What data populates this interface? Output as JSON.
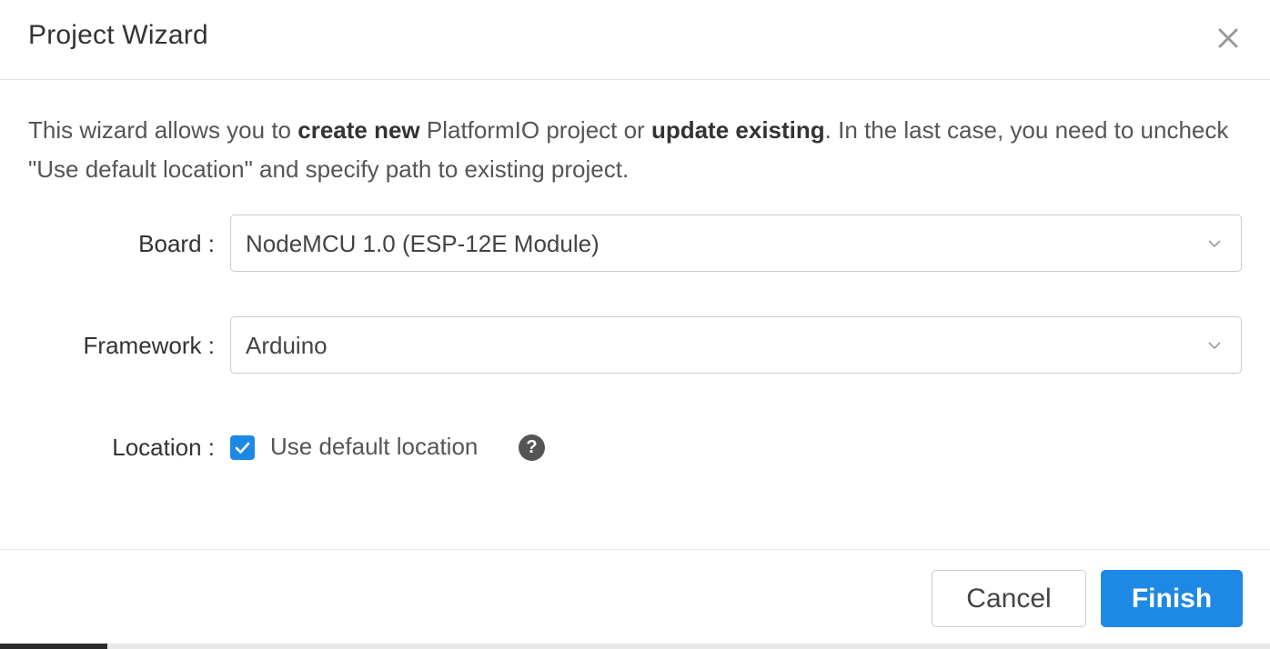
{
  "dialog": {
    "title": "Project Wizard",
    "close_icon": "close-icon"
  },
  "intro": {
    "part1": "This wizard allows you to ",
    "bold1": "create new",
    "part2": " PlatformIO project or ",
    "bold2": "update existing",
    "part3": ". In the last case, you need to uncheck \"Use default location\" and specify path to existing project."
  },
  "form": {
    "board": {
      "label": "Board :",
      "value": "NodeMCU 1.0 (ESP-12E Module)"
    },
    "framework": {
      "label": "Framework :",
      "value": "Arduino"
    },
    "location": {
      "label": "Location :",
      "checkbox_label": "Use default location",
      "checked": true,
      "help": "?"
    }
  },
  "footer": {
    "cancel_label": "Cancel",
    "finish_label": "Finish"
  },
  "colors": {
    "accent": "#1e88e5",
    "text": "#333333",
    "border": "#cccccc"
  }
}
